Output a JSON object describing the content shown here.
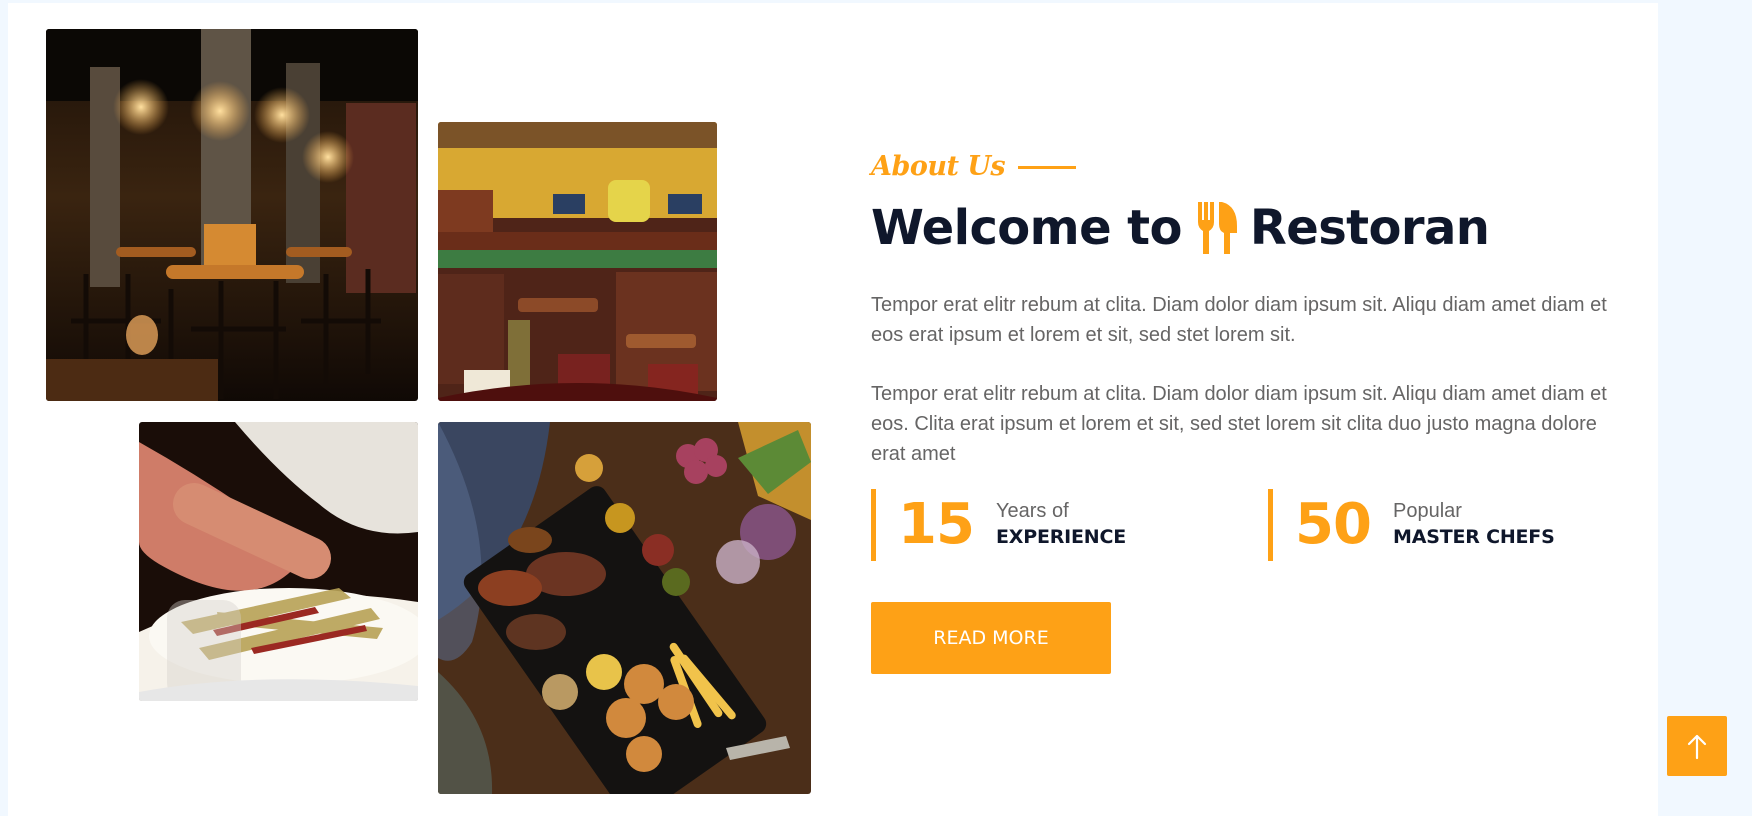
{
  "about": {
    "section_label": "About Us",
    "heading_prefix": "Welcome to",
    "brand_name": "Restoran",
    "paragraphs": [
      "Tempor erat elitr rebum at clita. Diam dolor diam ipsum sit. Aliqu diam amet diam et eos erat ipsum et lorem et sit, sed stet lorem sit.",
      "Tempor erat elitr rebum at clita. Diam dolor diam ipsum sit. Aliqu diam amet diam et eos. Clita erat ipsum et lorem et sit, sed stet lorem sit clita duo justo magna dolore erat amet"
    ],
    "stats": [
      {
        "number": "15",
        "line1": "Years of",
        "line2": "EXPERIENCE"
      },
      {
        "number": "50",
        "line1": "Popular",
        "line2": "MASTER CHEFS"
      }
    ],
    "button_label": "Read More"
  },
  "images": [
    {
      "name": "restaurant-dining-room-photo",
      "subject": "restaurant interior with tables and bar stools"
    },
    {
      "name": "restaurant-bar-photo",
      "subject": "restaurant bar and booth seating"
    },
    {
      "name": "plated-salad-photo",
      "subject": "person eating salad"
    },
    {
      "name": "food-platter-photo",
      "subject": "grilled meat platter with fries, buns and fruit"
    }
  ],
  "icons": {
    "brand": "utensils-icon",
    "back_to_top": "arrow-up-icon"
  },
  "colors": {
    "accent": "#fea116",
    "heading": "#0f172b",
    "body_text": "#666565",
    "page_background": "#f1f8ff",
    "panel_background": "#ffffff"
  }
}
